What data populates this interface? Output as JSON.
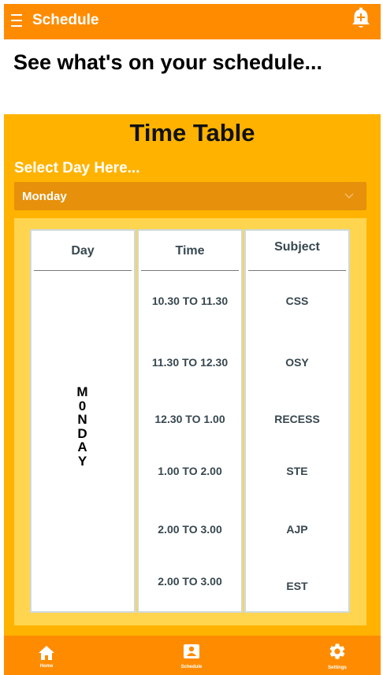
{
  "appbar": {
    "title": "Schedule",
    "menu_icon": "hamburger-menu-icon",
    "action_icon": "add-alarm-bell-icon"
  },
  "hero": {
    "heading": "See what's on your schedule..."
  },
  "timetable": {
    "title": "Time Table",
    "select_label": "Select Day Here...",
    "selected_day": "Monday",
    "headers": {
      "day": "Day",
      "time": "Time",
      "subject": "Subject"
    },
    "day_letters": [
      "M",
      "0",
      "N",
      "D",
      "A",
      "Y"
    ],
    "rows": [
      {
        "time": "10.30 TO 11.30",
        "subject": "CSS"
      },
      {
        "time": "11.30 TO 12.30",
        "subject": "OSY"
      },
      {
        "time": "12.30 TO 1.00",
        "subject": "RECESS"
      },
      {
        "time": "1.00 TO 2.00",
        "subject": "STE"
      },
      {
        "time": "2.00 TO 3.00",
        "subject": "AJP"
      },
      {
        "time": "2.00 TO 3.00",
        "subject": "EST"
      }
    ]
  },
  "bottom_nav": {
    "items": [
      {
        "label": "Home",
        "icon": "home-icon"
      },
      {
        "label": "Schedule",
        "icon": "schedule-icon"
      },
      {
        "label": "Settings",
        "icon": "gear-icon"
      }
    ]
  },
  "colors": {
    "appbar": "#ff8c00",
    "content": "#ffb300",
    "select": "#e6900c",
    "table_bg": "#ffd54f"
  }
}
